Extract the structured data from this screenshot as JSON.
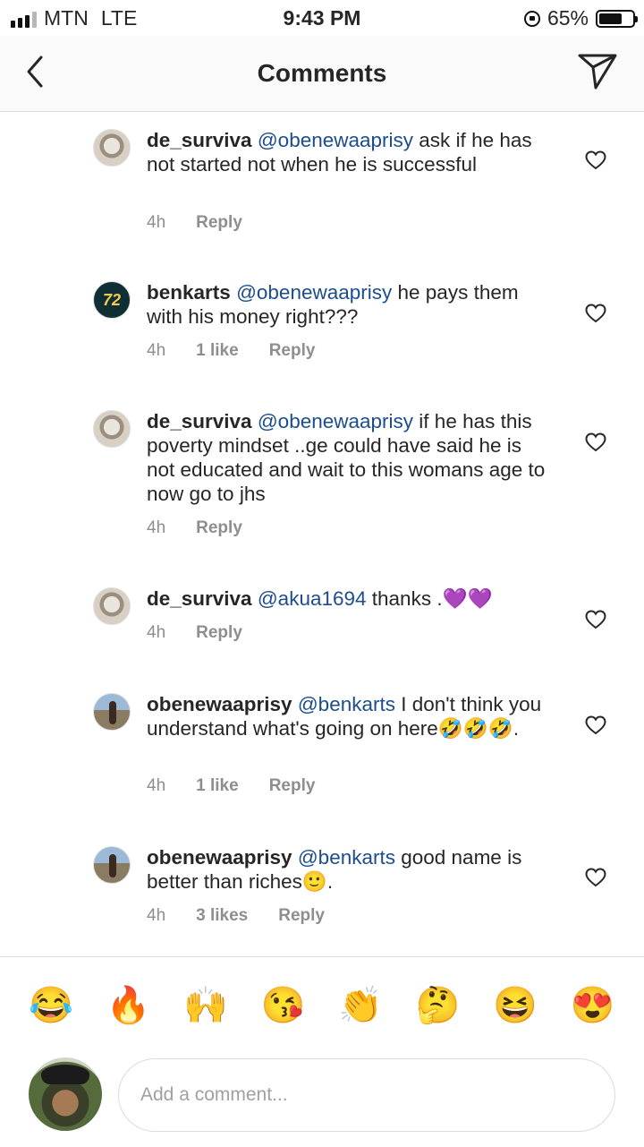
{
  "status_bar": {
    "carrier": "MTN",
    "network": "LTE",
    "time": "9:43 PM",
    "battery": "65%",
    "battery_level": 0.65
  },
  "header": {
    "title": "Comments",
    "back_icon": "chevron-left-icon",
    "send_icon": "paper-plane-icon"
  },
  "comments": [
    {
      "username": "de_surviva",
      "mention": "@obenewaaprisy",
      "text": " ask if he has not started not when he is successful",
      "time": "4h",
      "likes": "",
      "reply": "Reply"
    },
    {
      "username": "benkarts",
      "mention": "@obenewaaprisy",
      "text": " he pays them with his money right???",
      "time": "4h",
      "likes": "1 like",
      "reply": "Reply"
    },
    {
      "username": "de_surviva",
      "mention": "@obenewaaprisy",
      "text": " if he has this poverty mindset ..ge could have said he is not educated and wait to this womans age to now go to jhs",
      "time": "4h",
      "likes": "",
      "reply": "Reply"
    },
    {
      "username": "de_surviva",
      "mention": "@akua1694",
      "text": " thanks .💜💜",
      "time": "4h",
      "likes": "",
      "reply": "Reply"
    },
    {
      "username": "obenewaaprisy",
      "mention": "@benkarts",
      "text": " I don't think you understand what's going on here🤣🤣🤣.",
      "time": "4h",
      "likes": "1 like",
      "reply": "Reply"
    },
    {
      "username": "obenewaaprisy",
      "mention": "@benkarts",
      "text": " good name is better than riches🙂.",
      "time": "4h",
      "likes": "3 likes",
      "reply": "Reply"
    }
  ],
  "emoji_bar": [
    "😂",
    "🔥",
    "🙌",
    "😘",
    "👏",
    "🤔",
    "😆",
    "😍"
  ],
  "composer": {
    "placeholder": "Add a comment..."
  },
  "colors": {
    "mention": "#1c4d8c",
    "meta": "#8e8e8e",
    "divider": "#dbdbdb"
  }
}
